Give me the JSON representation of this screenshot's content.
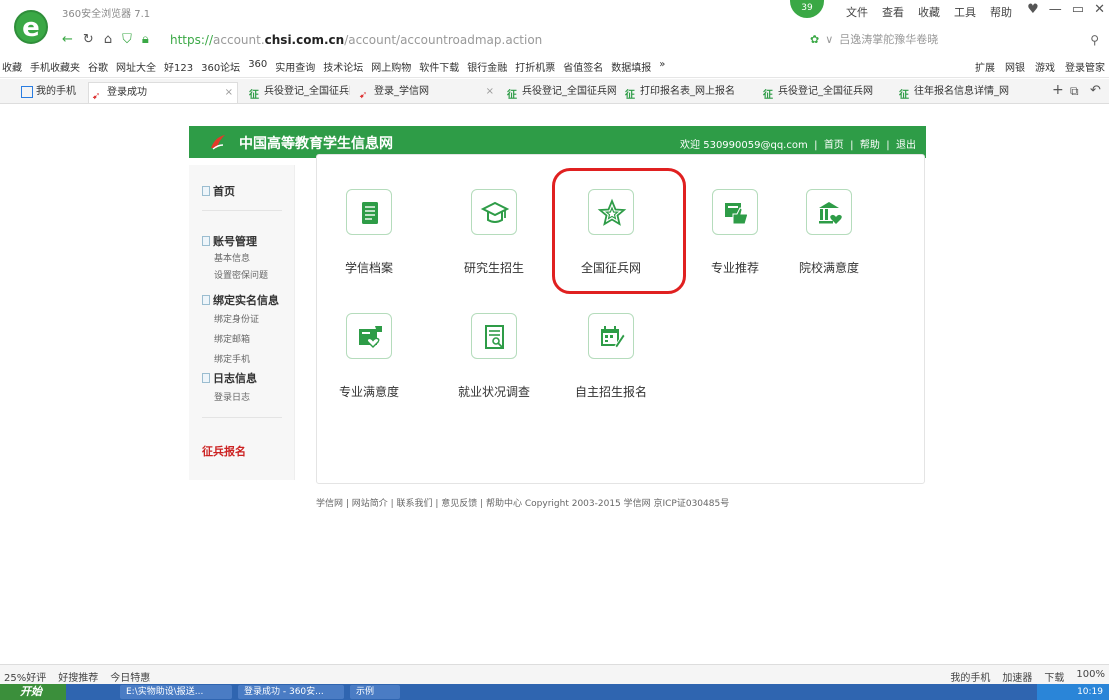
{
  "window": {
    "title": "360安全浏览器 7.1",
    "badge": "39"
  },
  "top_menu": [
    "文件",
    "查看",
    "收藏",
    "工具",
    "帮助"
  ],
  "address": {
    "scheme": "https://",
    "host_pre": "account.",
    "host": "chsi.com.cn",
    "path": "/account/accountroadmap.action"
  },
  "search": {
    "placeholder": "吕逸涛掌舵豫华卷晓"
  },
  "bookmarks": {
    "left": [
      "收藏",
      "手机收藏夹",
      "谷歌",
      "网址大全",
      "好123",
      "360论坛",
      "360",
      "实用查询",
      "技术论坛",
      "网上购物",
      "软件下载",
      "银行金融",
      "打折机票",
      "省值签名",
      "数据填报",
      "»"
    ],
    "right": [
      "扩展",
      "网银",
      "游戏",
      "登录管家"
    ]
  },
  "tabs": [
    {
      "label": "我的手机"
    },
    {
      "label": "登录成功"
    },
    {
      "label": "兵役登记_全国征兵网"
    },
    {
      "label": "登录_学信网"
    },
    {
      "label": "兵役登记_全国征兵网"
    },
    {
      "label": "打印报名表_网上报名"
    },
    {
      "label": "兵役登记_全国征兵网"
    },
    {
      "label": "往年报名信息详情_网"
    }
  ],
  "site": {
    "title": "中国高等教育学生信息网",
    "welcome": "欢迎 530990059@qq.com",
    "link_home": "首页",
    "link_help": "帮助",
    "link_logout": "退出"
  },
  "sidebar": {
    "home": "首页",
    "account": "账号管理",
    "account_items": [
      "基本信息",
      "设置密保问题"
    ],
    "realname": "绑定实名信息",
    "realname_items": [
      "绑定身份证",
      "绑定邮箱",
      "绑定手机"
    ],
    "log": "日志信息",
    "log_items": [
      "登录日志"
    ],
    "enlist": "征兵报名"
  },
  "tiles": [
    {
      "label": "学信档案",
      "icon": "book-icon"
    },
    {
      "label": "研究生招生",
      "icon": "graduation-cap-icon"
    },
    {
      "label": "全国征兵网",
      "icon": "star-icon"
    },
    {
      "label": "专业推荐",
      "icon": "thumbs-up-icon"
    },
    {
      "label": "院校满意度",
      "icon": "school-heart-icon"
    },
    {
      "label": "专业满意度",
      "icon": "chat-heart-icon"
    },
    {
      "label": "就业状况调查",
      "icon": "report-icon"
    },
    {
      "label": "自主招生报名",
      "icon": "calendar-edit-icon"
    }
  ],
  "footer": "学信网 | 网站简介 | 联系我们 | 意见反馈 | 帮助中心   Copyright 2003-2015 学信网 京ICP证030485号",
  "status_bar": {
    "left": [
      "25%好评",
      "好搜推荐",
      "今日特惠"
    ],
    "right": [
      "我的手机",
      "加速器",
      "下载",
      "100%"
    ]
  },
  "taskbar": {
    "start": "开始",
    "items": [
      "E:\\实物助设\\报送...",
      "登录成功 - 360安...",
      "示例"
    ],
    "clock": "10:19"
  },
  "colors": {
    "site_green": "#2e9c47",
    "highlight_red": "#e02020"
  }
}
